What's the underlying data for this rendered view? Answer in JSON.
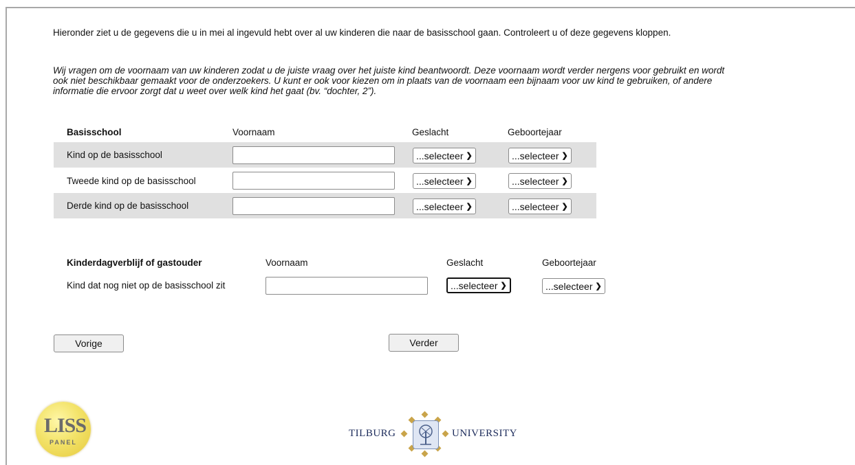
{
  "intro": {
    "text": "Hieronder ziet u de gegevens die u in mei al ingevuld hebt over al uw kinderen die naar de basisschool gaan. Controleert u of deze gegevens kloppen.",
    "italic": "Wij vragen om de voornaam van uw kinderen zodat u de juiste vraag over het juiste kind beantwoordt. Deze voornaam wordt verder nergens voor gebruikt en wordt ook niet beschikbaar gemaakt voor de onderzoekers. U kunt er ook voor kiezen om in plaats van de voornaam een bijnaam voor uw kind te gebruiken, of andere informatie die ervoor zorgt dat u weet over welk kind het gaat (bv. “dochter, 2”)."
  },
  "basisschool": {
    "heading": "Basisschool",
    "col_voornaam": "Voornaam",
    "col_geslacht": "Geslacht",
    "col_geboortejaar": "Geboortejaar",
    "rows": [
      {
        "label": "Kind op de basisschool",
        "voornaam": "",
        "geslacht": "...selecteer",
        "geboortejaar": "...selecteer"
      },
      {
        "label": "Tweede kind op de basisschool",
        "voornaam": "",
        "geslacht": "...selecteer",
        "geboortejaar": "...selecteer"
      },
      {
        "label": "Derde kind op de basisschool",
        "voornaam": "",
        "geslacht": "...selecteer",
        "geboortejaar": "...selecteer"
      }
    ]
  },
  "kinderdagverblijf": {
    "heading": "Kinderdagverblijf of gastouder",
    "col_voornaam": "Voornaam",
    "col_geslacht": "Geslacht",
    "col_geboortejaar": "Geboortejaar",
    "rows": [
      {
        "label": "Kind dat nog niet op de basisschool zit",
        "voornaam": "",
        "geslacht": "...selecteer",
        "geboortejaar": "...selecteer"
      }
    ]
  },
  "buttons": {
    "vorige": "Vorige",
    "verder": "Verder"
  },
  "logos": {
    "liss": "LISS",
    "liss_sub": "PANEL",
    "tilburg_left": "TILBURG",
    "tilburg_right": "UNIVERSITY"
  },
  "icons": {
    "select_chevron": "chevron-down-icon"
  },
  "colors": {
    "row_background": "#e0e0e0",
    "button_background": "#f0f0f0",
    "liss_yellow": "#f3e36a",
    "tilburg_gold": "#c9a44a",
    "tilburg_navy": "#1b2a5a"
  }
}
